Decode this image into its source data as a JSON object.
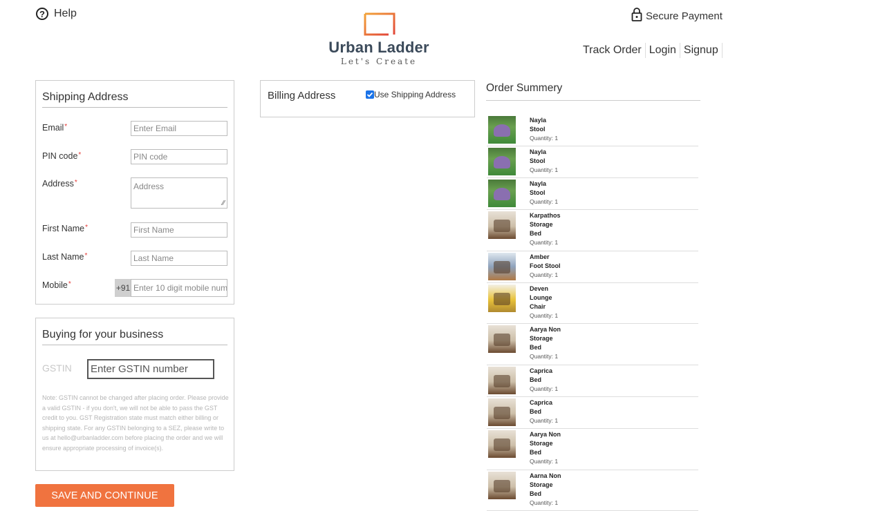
{
  "header": {
    "help_label": "Help",
    "logo_name": "Urban Ladder",
    "logo_tagline": "Let's Create",
    "secure_label": "Secure Payment",
    "nav": [
      "Track Order",
      "Login",
      "Signup"
    ]
  },
  "shipping": {
    "title": "Shipping Address",
    "fields": [
      {
        "label": "Email",
        "placeholder": "Enter Email"
      },
      {
        "label": "PIN code",
        "placeholder": "PIN code"
      },
      {
        "label": "Address",
        "placeholder": "Address"
      },
      {
        "label": "First Name",
        "placeholder": "First Name"
      },
      {
        "label": "Last Name",
        "placeholder": "Last Name"
      },
      {
        "label": "Mobile",
        "prefix": "+91",
        "placeholder": "Enter 10 digit mobile num"
      }
    ]
  },
  "business": {
    "title": "Buying for your business",
    "gstin_label": "GSTIN",
    "gstin_placeholder": "Enter GSTIN number",
    "note": "Note: GSTIN cannot be changed after placing order. Please provide a valid GSTIN - if you don't, we will not be able to pass the GST credit to you. GST Registration state must match either billing or shipping state. For any GSTIN belonging to a SEZ, please write to us at hello@urbanladder.com before placing the order and we will ensure appropriate processing of invoice(s)."
  },
  "billing": {
    "title": "Billing Address",
    "checkbox_label": "Use Shipping Address",
    "checked": true
  },
  "order_summary": {
    "title": "Order Summery",
    "items": [
      {
        "name": [
          "Nayla",
          "Stool"
        ],
        "qty": "Quantity: 1",
        "icon": "stool-thumbnail"
      },
      {
        "name": [
          "Nayla",
          "Stool"
        ],
        "qty": "Quantity: 1",
        "icon": "stool-thumbnail"
      },
      {
        "name": [
          "Nayla",
          "Stool"
        ],
        "qty": "Quantity: 1",
        "icon": "stool-thumbnail"
      },
      {
        "name": [
          "Karpathos",
          "Storage",
          "Bed"
        ],
        "qty": "Quantity: 1",
        "icon": "bed-thumbnail"
      },
      {
        "name": [
          "Amber",
          "Foot Stool"
        ],
        "qty": "Quantity: 1",
        "icon": "footstool-thumbnail"
      },
      {
        "name": [
          "Deven",
          "Lounge",
          "Chair"
        ],
        "qty": "Quantity: 1",
        "icon": "chair-thumbnail"
      },
      {
        "name": [
          "Aarya Non",
          "Storage",
          "Bed"
        ],
        "qty": "Quantity: 1",
        "icon": "bed-thumbnail"
      },
      {
        "name": [
          "Caprica",
          "Bed"
        ],
        "qty": "Quantity: 1",
        "icon": "bed-thumbnail"
      },
      {
        "name": [
          "Caprica",
          "Bed"
        ],
        "qty": "Quantity: 1",
        "icon": "bed-thumbnail"
      },
      {
        "name": [
          "Aarya Non",
          "Storage",
          "Bed"
        ],
        "qty": "Quantity: 1",
        "icon": "bed-thumbnail"
      },
      {
        "name": [
          "Aarna Non",
          "Storage",
          "Bed"
        ],
        "qty": "Quantity: 1",
        "icon": "bed-thumbnail"
      }
    ]
  },
  "actions": {
    "save_label": "SAVE AND CONTINUE"
  },
  "colors": {
    "accent": "#f0733f",
    "logo_orange": "#e8663a",
    "logo_text": "#3b4a5a",
    "required": "#e53935"
  }
}
